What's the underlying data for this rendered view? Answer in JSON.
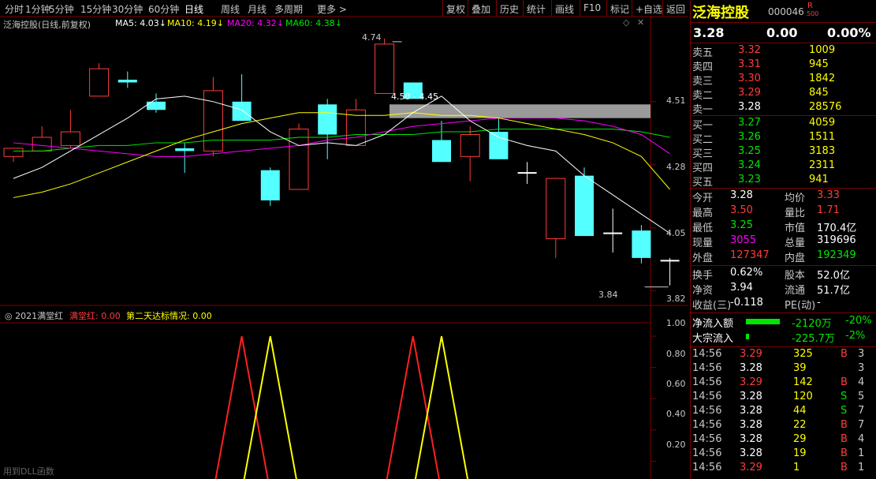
{
  "toolbar": {
    "timeframes": [
      "分时",
      "1分钟",
      "5分钟",
      "15分钟",
      "30分钟",
      "60分钟",
      "日线",
      "周线",
      "月线",
      "多周期",
      "更多 >"
    ],
    "active_timeframe": "日线",
    "buttons": [
      "复权",
      "叠加",
      "历史",
      "统计",
      "画线",
      "F10",
      "标记",
      "+自选",
      "返回"
    ]
  },
  "chart_header": {
    "title": "泛海控股(日线,前复权)",
    "ma5": "MA5: 4.03↓",
    "ma10": "MA10: 4.19↓",
    "ma20": "MA20: 4.32↓",
    "ma60": "MA60: 4.38↓"
  },
  "colors": {
    "up": "#ff3c3c",
    "down": "#54ffff",
    "ma5": "#ffffff",
    "ma10": "#ffff00",
    "ma20": "#ff00ff",
    "ma60": "#00e600",
    "border": "#7a0000"
  },
  "annotations": {
    "high": "4.74",
    "low": "3.84",
    "gap_label": "4.50 - 4.45"
  },
  "price_axis": [
    "4.51",
    "4.28",
    "4.05",
    "3.82"
  ],
  "indicator": {
    "name": "2021满堂红",
    "series1": "满堂红: 0.00",
    "series2": "第二天达标情况: 0.00",
    "axis": [
      "1.00",
      "0.80",
      "0.60",
      "0.40",
      "0.20"
    ],
    "footer": "用到DLL函数"
  },
  "chart_data": {
    "type": "candlestick",
    "candles": [
      {
        "o": 4.31,
        "c": 4.34,
        "h": 4.34,
        "l": 4.29
      },
      {
        "o": 4.33,
        "c": 4.38,
        "h": 4.42,
        "l": 4.33
      },
      {
        "o": 4.35,
        "c": 4.4,
        "h": 4.48,
        "l": 4.34
      },
      {
        "o": 4.53,
        "c": 4.63,
        "h": 4.65,
        "l": 4.53
      },
      {
        "o": 4.59,
        "c": 4.58,
        "h": 4.62,
        "l": 4.56
      },
      {
        "o": 4.51,
        "c": 4.48,
        "h": 4.54,
        "l": 4.47
      },
      {
        "o": 4.34,
        "c": 4.33,
        "h": 4.36,
        "l": 4.25
      },
      {
        "o": 4.33,
        "c": 4.55,
        "h": 4.6,
        "l": 4.31
      },
      {
        "o": 4.51,
        "c": 4.44,
        "h": 4.61,
        "l": 4.44
      },
      {
        "o": 4.26,
        "c": 4.15,
        "h": 4.27,
        "l": 4.13
      },
      {
        "o": 4.19,
        "c": 4.41,
        "h": 4.43,
        "l": 4.19
      },
      {
        "o": 4.5,
        "c": 4.39,
        "h": 4.52,
        "l": 4.3
      },
      {
        "o": 4.35,
        "c": 4.48,
        "h": 4.52,
        "l": 4.35
      },
      {
        "o": 4.54,
        "c": 4.72,
        "h": 4.74,
        "l": 4.54
      },
      {
        "o": 4.58,
        "c": 4.52,
        "h": 4.58,
        "l": 4.52
      },
      {
        "o": 4.37,
        "c": 4.29,
        "h": 4.44,
        "l": 4.29
      },
      {
        "o": 4.31,
        "c": 4.39,
        "h": 4.42,
        "l": 4.22
      },
      {
        "o": 4.4,
        "c": 4.3,
        "h": 4.45,
        "l": 4.3
      },
      {
        "o": 4.25,
        "c": 4.25,
        "h": 4.29,
        "l": 4.21
      },
      {
        "o": 4.01,
        "c": 4.23,
        "h": 4.23,
        "l": 3.94
      },
      {
        "o": 4.24,
        "c": 4.02,
        "h": 4.27,
        "l": 4.02
      },
      {
        "o": 4.03,
        "c": 4.03,
        "h": 4.12,
        "l": 3.96
      },
      {
        "o": 4.04,
        "c": 3.94,
        "h": 4.06,
        "l": 3.92
      },
      {
        "o": 3.93,
        "c": 3.93,
        "h": 3.94,
        "l": 3.84
      }
    ],
    "ma5": [
      4.23,
      4.27,
      4.33,
      4.39,
      4.45,
      4.52,
      4.53,
      4.51,
      4.48,
      4.4,
      4.35,
      4.36,
      4.35,
      4.39,
      4.47,
      4.53,
      4.44,
      4.38,
      4.35,
      4.33,
      4.24,
      4.17,
      4.1,
      4.03
    ],
    "ma10": [
      4.16,
      4.18,
      4.21,
      4.25,
      4.29,
      4.33,
      4.37,
      4.4,
      4.43,
      4.45,
      4.47,
      4.47,
      4.46,
      4.46,
      4.47,
      4.46,
      4.46,
      4.45,
      4.43,
      4.41,
      4.39,
      4.36,
      4.31,
      4.19
    ],
    "ma20": [
      4.36,
      4.35,
      4.34,
      4.33,
      4.32,
      4.31,
      4.31,
      4.32,
      4.33,
      4.34,
      4.35,
      4.37,
      4.38,
      4.4,
      4.42,
      4.43,
      4.44,
      4.45,
      4.45,
      4.45,
      4.44,
      4.42,
      4.39,
      4.32
    ],
    "ma60": [
      4.33,
      4.33,
      4.34,
      4.35,
      4.35,
      4.36,
      4.36,
      4.37,
      4.37,
      4.37,
      4.38,
      4.38,
      4.39,
      4.39,
      4.39,
      4.4,
      4.4,
      4.41,
      4.41,
      4.41,
      4.41,
      4.41,
      4.4,
      4.38
    ],
    "signal1": [
      0,
      0,
      0,
      0,
      0,
      0,
      0,
      0,
      1,
      0,
      0,
      0,
      0,
      0,
      1,
      0,
      0,
      0,
      0,
      0,
      0,
      0,
      0,
      0
    ],
    "signal2": [
      0,
      0,
      0,
      0,
      0,
      0,
      0,
      0,
      0,
      1,
      0,
      0,
      0,
      0,
      0,
      1,
      0,
      0,
      0,
      0,
      0,
      0,
      0,
      0
    ],
    "ylim": [
      3.79,
      4.78
    ]
  },
  "quote": {
    "name": "泛海控股",
    "code": "000046",
    "badge_top": "R",
    "badge_bottom": "500",
    "price": "3.28",
    "change": "0.00",
    "pct": "0.00%"
  },
  "orderbook": {
    "sell": [
      {
        "label": "卖五",
        "price": "3.32",
        "vol": "1009",
        "color": "red"
      },
      {
        "label": "卖四",
        "price": "3.31",
        "vol": "945",
        "color": "red"
      },
      {
        "label": "卖三",
        "price": "3.30",
        "vol": "1842",
        "color": "red"
      },
      {
        "label": "卖二",
        "price": "3.29",
        "vol": "845",
        "color": "red"
      },
      {
        "label": "卖一",
        "price": "3.28",
        "vol": "28576",
        "color": "white"
      }
    ],
    "buy": [
      {
        "label": "买一",
        "price": "3.27",
        "vol": "4059",
        "color": "green"
      },
      {
        "label": "买二",
        "price": "3.26",
        "vol": "1511",
        "color": "green"
      },
      {
        "label": "买三",
        "price": "3.25",
        "vol": "3183",
        "color": "green"
      },
      {
        "label": "买四",
        "price": "3.24",
        "vol": "2311",
        "color": "green"
      },
      {
        "label": "买五",
        "price": "3.23",
        "vol": "941",
        "color": "green"
      }
    ]
  },
  "stats": [
    {
      "l1": "今开",
      "v1": "3.28",
      "c1": "white",
      "l2": "均价",
      "v2": "3.33",
      "c2": "red"
    },
    {
      "l1": "最高",
      "v1": "3.50",
      "c1": "red",
      "l2": "量比",
      "v2": "1.71",
      "c2": "red"
    },
    {
      "l1": "最低",
      "v1": "3.25",
      "c1": "green",
      "l2": "市值",
      "v2": "170.4亿",
      "c2": "white"
    },
    {
      "l1": "现量",
      "v1": "3055",
      "c1": "magenta",
      "l2": "总量",
      "v2": "319696",
      "c2": "white"
    },
    {
      "l1": "外盘",
      "v1": "127347",
      "c1": "red",
      "l2": "内盘",
      "v2": "192349",
      "c2": "green"
    }
  ],
  "stats2": [
    {
      "l1": "换手",
      "v1": "0.62%",
      "c1": "white",
      "l2": "股本",
      "v2": "52.0亿",
      "c2": "white"
    },
    {
      "l1": "净资",
      "v1": "3.94",
      "c1": "white",
      "l2": "流通",
      "v2": "51.7亿",
      "c2": "white"
    },
    {
      "l1": "收益(三)",
      "v1": "-0.118",
      "c1": "white",
      "l2": "PE(动)",
      "v2": "-",
      "c2": "white"
    }
  ],
  "flows": [
    {
      "label": "净流入额",
      "value": "-2120万",
      "pct": "-20%",
      "bar": 0.8
    },
    {
      "label": "大宗流入",
      "value": "-225.7万",
      "pct": "-2%",
      "bar": 0.08
    }
  ],
  "ticks": [
    {
      "t": "14:56",
      "p": "3.29",
      "pc": "red",
      "v": "325",
      "d": "B",
      "n": "3"
    },
    {
      "t": "14:56",
      "p": "3.28",
      "pc": "white",
      "v": "39",
      "d": "",
      "n": "3"
    },
    {
      "t": "14:56",
      "p": "3.29",
      "pc": "red",
      "v": "142",
      "d": "B",
      "n": "4"
    },
    {
      "t": "14:56",
      "p": "3.28",
      "pc": "white",
      "v": "120",
      "d": "S",
      "n": "5"
    },
    {
      "t": "14:56",
      "p": "3.28",
      "pc": "white",
      "v": "44",
      "d": "S",
      "n": "7"
    },
    {
      "t": "14:56",
      "p": "3.28",
      "pc": "white",
      "v": "22",
      "d": "B",
      "n": "7"
    },
    {
      "t": "14:56",
      "p": "3.28",
      "pc": "white",
      "v": "29",
      "d": "B",
      "n": "4"
    },
    {
      "t": "14:56",
      "p": "3.28",
      "pc": "white",
      "v": "19",
      "d": "B",
      "n": "1"
    },
    {
      "t": "14:56",
      "p": "3.29",
      "pc": "red",
      "v": "1",
      "d": "B",
      "n": "1"
    }
  ]
}
